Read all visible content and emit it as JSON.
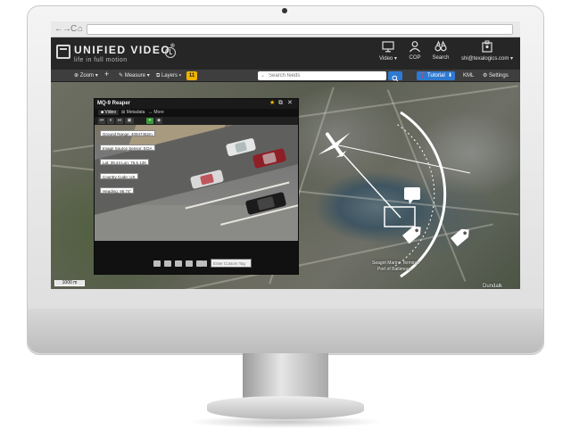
{
  "browser": {
    "back_glyph": "←",
    "forward_glyph": "→",
    "reload_glyph": "C",
    "home_glyph": "⌂"
  },
  "app": {
    "brand_name": "UNIFIED VIDEO",
    "brand_mark": "®",
    "tagline": "life in full motion",
    "header_items": [
      {
        "label": "Video ▾",
        "icon": "monitor-icon"
      },
      {
        "label": "COP",
        "icon": "person-icon"
      },
      {
        "label": "Search",
        "icon": "binoculars-icon"
      },
      {
        "label": "shi@texalogics.com ▾",
        "icon": "badge-icon"
      }
    ]
  },
  "toolbar": {
    "zoom_label": "⊕ Zoom ▾",
    "plus_label": "+",
    "measure_label": "✎ Measure ▾",
    "layers_label": "⧉ Layers ▾",
    "layers_badge": "11",
    "search_placeholder": "Search feeds",
    "search_chevron": "⌄",
    "tutorial_label": "❓ Tutorial",
    "download_label": "⬇",
    "kml_label": "KML",
    "settings_label": "⚙ Settings"
  },
  "map": {
    "labels": [
      "Seagirt Marine Terminal",
      "Port of Baltimore",
      "Dundalk"
    ],
    "scale_label": "1000 m"
  },
  "video_panel": {
    "title": "MQ-9 Reaper",
    "tabs": [
      "■ Video",
      "⊞ Metadata",
      "↔ More"
    ],
    "controls": [
      "⏮",
      "⏸",
      "⏭",
      "▣",
      "⌖",
      "◆"
    ],
    "telemetry": [
      "Ground Range: 40947462m",
      "Image Source Sensor: EOA",
      "Lat: 39.24 Lon: 76.6 12K",
      "Country Code: US",
      "Heading: 86.74°"
    ],
    "tag_placeholder": "Enter Custom Tag"
  },
  "colors": {
    "header_bg": "#262626",
    "toolbar_bg": "#3e3e3e",
    "accent_blue": "#2f7ad1",
    "badge_yellow": "#f0b400",
    "status_green": "#3a9a3a"
  }
}
